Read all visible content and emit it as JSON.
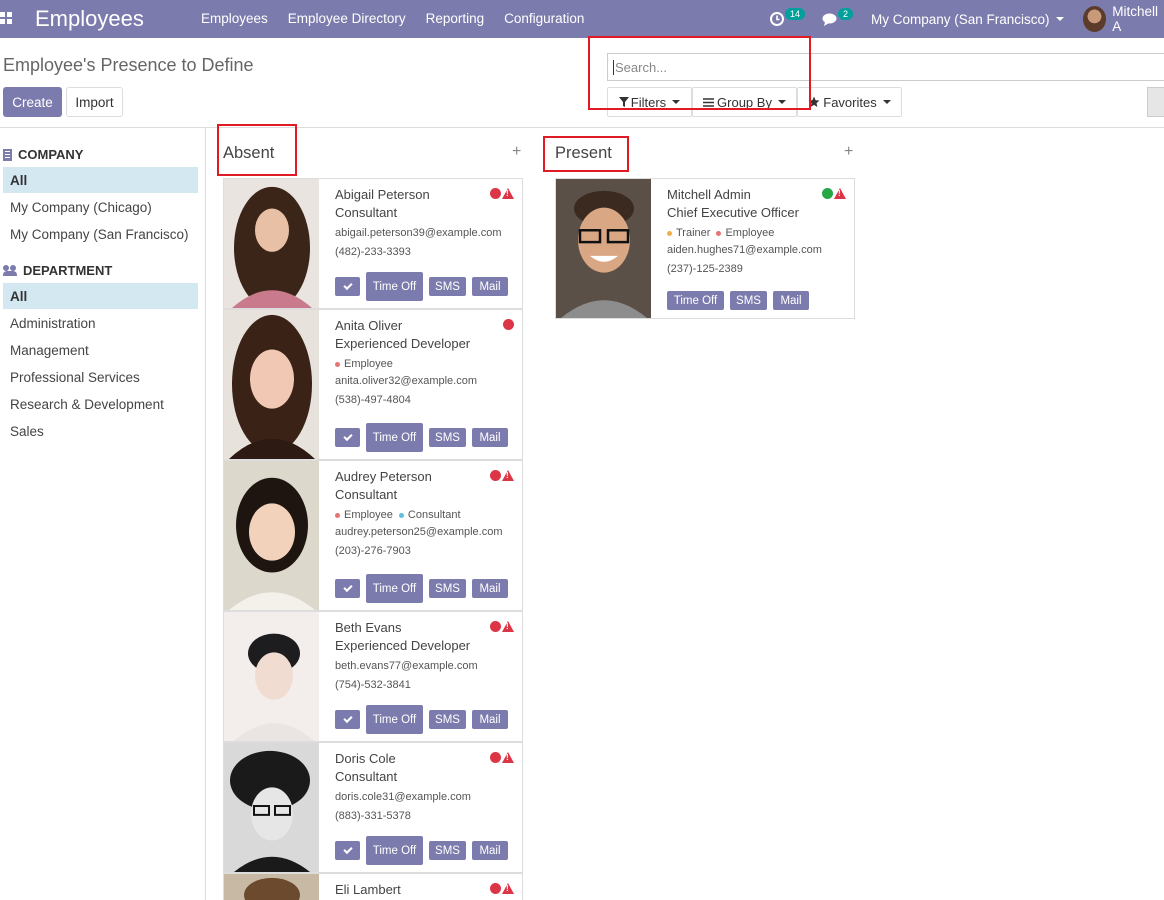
{
  "app": {
    "title": "Employees"
  },
  "menu": [
    "Employees",
    "Employee Directory",
    "Reporting",
    "Configuration"
  ],
  "systray": {
    "activity_icon": "clock-icon",
    "activity_count": "14",
    "chat_icon": "chat-icon",
    "chat_count": "2",
    "company": "My Company (San Francisco)",
    "user": "Mitchell A"
  },
  "page": {
    "breadcrumb": "Employee's Presence to Define",
    "create_label": "Create",
    "import_label": "Import"
  },
  "search": {
    "placeholder": "Search...",
    "filters_label": "Filters",
    "groupby_label": "Group By",
    "favorites_label": "Favorites"
  },
  "sidebar": {
    "company_heading": "COMPANY",
    "company_items": [
      "All",
      "My Company (Chicago)",
      "My Company (San Francisco)"
    ],
    "department_heading": "DEPARTMENT",
    "department_items": [
      "All",
      "Administration",
      "Management",
      "Professional Services",
      "Research & Development",
      "Sales"
    ]
  },
  "columns": [
    {
      "title": "Absent",
      "plus": "+"
    },
    {
      "title": "Present",
      "plus": "+"
    }
  ],
  "buttons": {
    "time_off": "Time Off",
    "sms": "SMS",
    "mail": "Mail"
  },
  "cards": {
    "abigail": {
      "name": "Abigail Peterson",
      "job": "Consultant",
      "email": "abigail.peterson39@example.com",
      "phone": "(482)-233-3393",
      "status_color": "#dc3545"
    },
    "anita": {
      "name": "Anita Oliver",
      "job": "Experienced Developer",
      "tags": [
        "Employee"
      ],
      "email": "anita.oliver32@example.com",
      "phone": "(538)-497-4804",
      "status_color": "#dc3545"
    },
    "audrey": {
      "name": "Audrey Peterson",
      "job": "Consultant",
      "tags": [
        "Employee",
        "Consultant"
      ],
      "email": "audrey.peterson25@example.com",
      "phone": "(203)-276-7903",
      "status_color": "#dc3545"
    },
    "beth": {
      "name": "Beth Evans",
      "job": "Experienced Developer",
      "email": "beth.evans77@example.com",
      "phone": "(754)-532-3841",
      "status_color": "#dc3545"
    },
    "doris": {
      "name": "Doris Cole",
      "job": "Consultant",
      "email": "doris.cole31@example.com",
      "phone": "(883)-331-5378",
      "status_color": "#dc3545"
    },
    "eli": {
      "name": "Eli Lambert",
      "status_color": "#dc3545"
    },
    "mitchell": {
      "name": "Mitchell Admin",
      "job": "Chief Executive Officer",
      "tags": [
        "Trainer",
        "Employee"
      ],
      "email": "aiden.hughes71@example.com",
      "phone": "(237)-125-2389",
      "status_color": "#28a745"
    }
  },
  "colors": {
    "brand": "#7c7bad",
    "absent": "#dc3545",
    "present": "#28a745",
    "active_filter": "#d4e8f2",
    "tag_employee": "#e57373",
    "tag_consultant": "#5bc0de",
    "tag_trainer": "#f0ad4e"
  }
}
